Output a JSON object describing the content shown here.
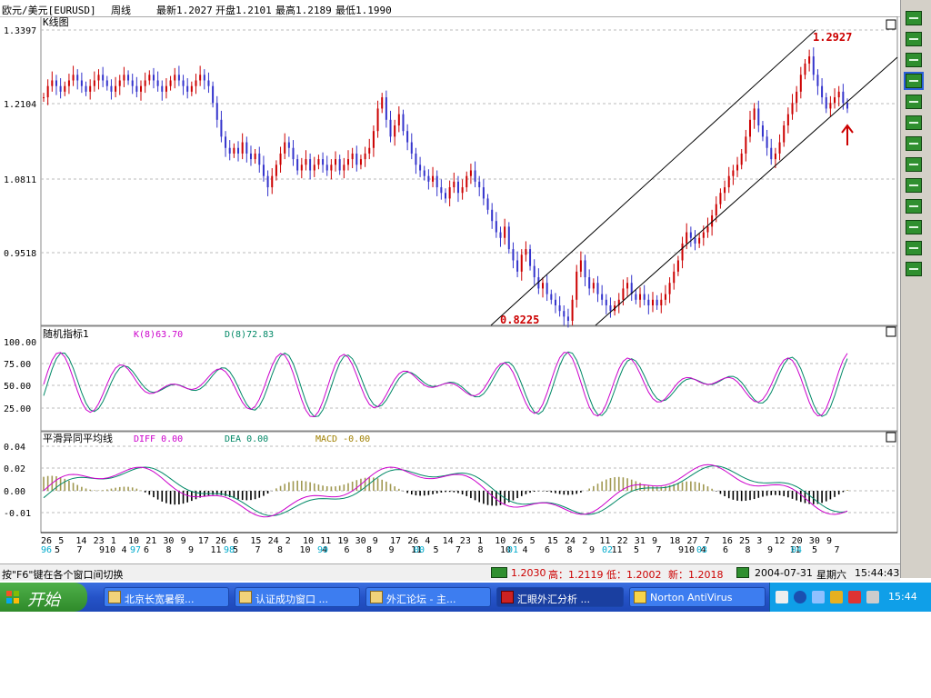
{
  "header": {
    "symbol": "欧元/美元[EURUSD]",
    "period": "周线",
    "latest": "最新1.2027",
    "open": "开盘1.2101",
    "high": "最高1.2189",
    "low": "最低1.1990"
  },
  "main_panel": {
    "title": "K线图",
    "ytick_labels": [
      "1.3397",
      "1.2104",
      "1.0811",
      "0.9518"
    ],
    "annotations": {
      "high": "1.2927",
      "low": "0.8225"
    }
  },
  "kdj_panel": {
    "title": "随机指标1",
    "k_label": "K(8)63.70",
    "d_label": "D(8)72.83",
    "ytick_labels": [
      "100.00",
      "75.00",
      "50.00",
      "25.00"
    ]
  },
  "macd_panel": {
    "title": "平滑异同平均线",
    "diff_label": "DIFF 0.00",
    "dea_label": "DEA 0.00",
    "macd_label": "MACD -0.00",
    "ytick_labels": [
      "0.04",
      "0.02",
      "0.00",
      "-0.01"
    ]
  },
  "xaxis": {
    "date_labels": [
      "26",
      "5",
      "14",
      "23",
      "1",
      "10",
      "21",
      "30",
      "9",
      "17",
      "26",
      "6",
      "15",
      "24",
      "2",
      "10",
      "11",
      "19",
      "30",
      "9",
      "17",
      "26",
      "4",
      "14",
      "23",
      "1",
      "10",
      "26",
      "5",
      "15",
      "24",
      "2",
      "11",
      "22",
      "31",
      "9",
      "18",
      "27",
      "7",
      "16",
      "25",
      "3",
      "12",
      "20",
      "30",
      "9"
    ],
    "month_labels": [
      "5",
      "7",
      "910",
      "4",
      "6",
      "8",
      "9",
      "11",
      "5",
      "7",
      "8",
      "10",
      "4",
      "6",
      "8",
      "9",
      "11",
      "5",
      "7",
      "8",
      "10",
      "4",
      "6",
      "8",
      "9",
      "11",
      "5",
      "7",
      "910",
      "4",
      "6",
      "8",
      "9",
      "11",
      "5",
      "7"
    ],
    "year_labels": [
      "96",
      "97",
      "98",
      "99",
      "00",
      "01",
      "02",
      "03",
      "04"
    ]
  },
  "statusbar": {
    "hint": "按\"F6\"键在各个窗口间切换",
    "price": "1.2030",
    "high": "高：1.2119",
    "low": "低：1.2002",
    "new": "新：1.2018",
    "date": "2004-07-31",
    "weekday": "星期六",
    "time": "15:44:43"
  },
  "taskbar": {
    "start_label": "开始",
    "tasks": [
      {
        "label": "北京长宽暑假..."
      },
      {
        "label": "认证成功窗口 ..."
      },
      {
        "label": "外汇论坛 - 主..."
      },
      {
        "label": "汇眼外汇分析 ..."
      },
      {
        "label": "Norton AntiVirus"
      }
    ],
    "clock": "15:44"
  },
  "toolbar": {
    "icons": [
      "cursor-icon",
      "text-icon",
      "line-icon",
      "channel-icon",
      "fib-icon",
      "ray-icon",
      "arc-icon",
      "grid1-icon",
      "grid2-icon",
      "grid3-icon",
      "grid4-icon",
      "period-icon",
      "delete-icon"
    ]
  },
  "colors": {
    "bull": "#cc0000",
    "bear": "#3333cc",
    "k_line": "#cc00cc",
    "d_line": "#008866",
    "macd_pos": "#a09850",
    "macd_neg": "#000000",
    "accent_label": "#cc0000",
    "year_label": "#00aacc"
  },
  "chart_data": {
    "type": "line",
    "title": "欧元/美元[EURUSD] 周线",
    "series": [
      {
        "name": "K线图",
        "values": [
          1.22,
          1.24,
          1.25,
          1.24,
          1.23,
          1.24,
          1.25,
          1.26,
          1.25,
          1.24,
          1.23,
          1.24,
          1.25,
          1.26,
          1.25,
          1.24,
          1.23,
          1.24,
          1.25,
          1.26,
          1.25,
          1.24,
          1.23,
          1.24,
          1.25,
          1.26,
          1.25,
          1.24,
          1.23,
          1.24,
          1.25,
          1.26,
          1.25,
          1.24,
          1.23,
          1.24,
          1.25,
          1.26,
          1.25,
          1.24,
          1.21,
          1.18,
          1.15,
          1.13,
          1.12,
          1.13,
          1.12,
          1.14,
          1.12,
          1.11,
          1.12,
          1.1,
          1.08,
          1.06,
          1.08,
          1.1,
          1.12,
          1.14,
          1.13,
          1.11,
          1.09,
          1.1,
          1.11,
          1.09,
          1.1,
          1.11,
          1.1,
          1.09,
          1.1,
          1.11,
          1.09,
          1.1,
          1.11,
          1.12,
          1.1,
          1.11,
          1.12,
          1.13,
          1.16,
          1.2,
          1.22,
          1.18,
          1.15,
          1.17,
          1.19,
          1.16,
          1.14,
          1.12,
          1.1,
          1.09,
          1.08,
          1.07,
          1.08,
          1.06,
          1.05,
          1.04,
          1.06,
          1.07,
          1.05,
          1.06,
          1.08,
          1.09,
          1.07,
          1.06,
          1.04,
          1.02,
          1.0,
          0.98,
          0.97,
          0.99,
          0.95,
          0.93,
          0.91,
          0.94,
          0.95,
          0.92,
          0.9,
          0.88,
          0.89,
          0.87,
          0.86,
          0.85,
          0.84,
          0.83,
          0.8225,
          0.86,
          0.91,
          0.93,
          0.9,
          0.88,
          0.89,
          0.87,
          0.86,
          0.85,
          0.84,
          0.85,
          0.86,
          0.88,
          0.89,
          0.87,
          0.86,
          0.87,
          0.86,
          0.85,
          0.86,
          0.85,
          0.86,
          0.87,
          0.89,
          0.91,
          0.93,
          0.96,
          0.98,
          0.97,
          0.96,
          0.97,
          0.98,
          0.99,
          1.01,
          1.03,
          1.05,
          1.06,
          1.08,
          1.09,
          1.1,
          1.12,
          1.15,
          1.18,
          1.2,
          1.17,
          1.15,
          1.13,
          1.11,
          1.12,
          1.14,
          1.17,
          1.19,
          1.21,
          1.23,
          1.26,
          1.28,
          1.2927,
          1.26,
          1.24,
          1.22,
          1.2,
          1.21,
          1.22,
          1.23,
          1.21,
          1.2
        ]
      }
    ],
    "ylim": [
      0.8225,
      1.3397
    ],
    "annotations": [
      "1.2927",
      "0.8225"
    ]
  }
}
